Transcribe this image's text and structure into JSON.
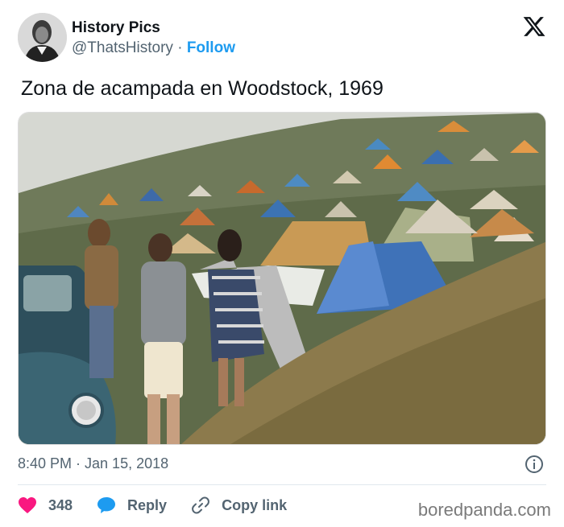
{
  "tweet": {
    "author_name": "History Pics",
    "handle": "@ThatsHistory",
    "separator": "·",
    "follow_label": "Follow",
    "text": "Zona de acampada en Woodstock, 1969",
    "timestamp": "8:40 PM · Jan 15, 2018",
    "likes": "348",
    "reply_label": "Reply",
    "copy_link_label": "Copy link"
  },
  "icons": {
    "platform": "x-logo-icon",
    "info": "info-icon",
    "like": "heart-icon",
    "reply": "reply-bubble-icon",
    "link": "link-icon"
  },
  "colors": {
    "follow": "#1d9bf0",
    "heart": "#f91880",
    "reply": "#1d9bf0",
    "secondary_text": "#536471"
  },
  "watermark": "boredpanda.com"
}
